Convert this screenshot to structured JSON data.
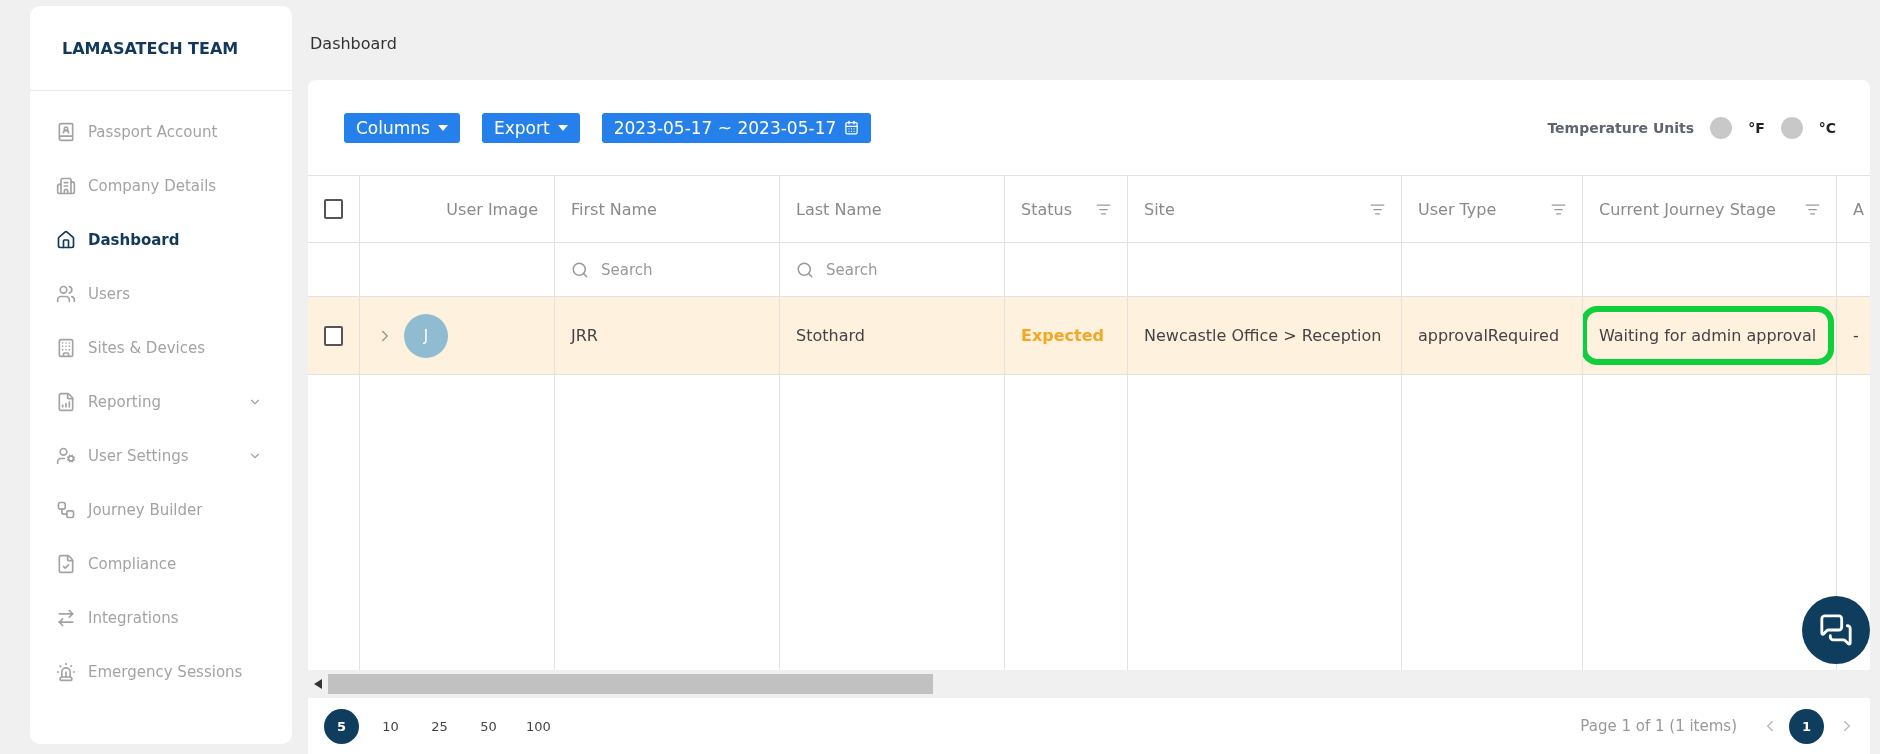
{
  "sidebar": {
    "title": "LAMASATECH TEAM",
    "items": [
      {
        "label": "Passport Account",
        "selected": false,
        "expandable": false
      },
      {
        "label": "Company Details",
        "selected": false,
        "expandable": false
      },
      {
        "label": "Dashboard",
        "selected": true,
        "expandable": false
      },
      {
        "label": "Users",
        "selected": false,
        "expandable": false
      },
      {
        "label": "Sites & Devices",
        "selected": false,
        "expandable": false
      },
      {
        "label": "Reporting",
        "selected": false,
        "expandable": true
      },
      {
        "label": "User Settings",
        "selected": false,
        "expandable": true
      },
      {
        "label": "Journey Builder",
        "selected": false,
        "expandable": false
      },
      {
        "label": "Compliance",
        "selected": false,
        "expandable": false
      },
      {
        "label": "Integrations",
        "selected": false,
        "expandable": false
      },
      {
        "label": "Emergency Sessions",
        "selected": false,
        "expandable": false
      }
    ]
  },
  "page_title": "Dashboard",
  "toolbar": {
    "buttons": [
      {
        "label": "Columns",
        "kind": "dropdown"
      },
      {
        "label": "Export",
        "kind": "dropdown"
      },
      {
        "label": "2023-05-17 ~ 2023-05-17",
        "kind": "date"
      }
    ],
    "temperature": {
      "label": "Temperature Units",
      "options": [
        {
          "label": "°F",
          "selected": false
        },
        {
          "label": "°C",
          "selected": false
        }
      ]
    }
  },
  "table": {
    "all_checked": false,
    "columns": [
      {
        "label": "User Image",
        "filter": false,
        "search": false
      },
      {
        "label": "First Name",
        "filter": false,
        "search": true,
        "placeholder": "Search"
      },
      {
        "label": "Last Name",
        "filter": false,
        "search": true,
        "placeholder": "Search"
      },
      {
        "label": "Status",
        "filter": true,
        "search": false
      },
      {
        "label": "Site",
        "filter": true,
        "search": false
      },
      {
        "label": "User Type",
        "filter": true,
        "search": false
      },
      {
        "label": "Current Journey Stage",
        "filter": true,
        "search": false
      },
      {
        "label": "A",
        "search": false
      }
    ],
    "rows": [
      {
        "checked": false,
        "cells": [
          {
            "text": "J",
            "kind": "avatar",
            "highlighted": false
          },
          {
            "text": "JRR",
            "kind": "plain",
            "highlighted": false
          },
          {
            "text": "Stothard",
            "kind": "plain",
            "highlighted": false
          },
          {
            "text": "Expected",
            "kind": "status",
            "highlighted": false
          },
          {
            "text": "Newcastle Office > Reception",
            "kind": "plain",
            "highlighted": false
          },
          {
            "text": "approvalRequired",
            "kind": "plain",
            "highlighted": false
          },
          {
            "text": "Waiting for admin approval",
            "kind": "plain",
            "highlighted": true
          },
          {
            "text": "-",
            "kind": "plain",
            "highlighted": false
          }
        ]
      }
    ]
  },
  "pagination": {
    "sizes": [
      {
        "label": "5",
        "selected": true
      },
      {
        "label": "10",
        "selected": false
      },
      {
        "label": "25",
        "selected": false
      },
      {
        "label": "50",
        "selected": false
      },
      {
        "label": "100",
        "selected": false
      }
    ],
    "summary": "Page 1 of 1 (1 items)",
    "pages": [
      {
        "label": "1",
        "selected": true
      }
    ]
  }
}
